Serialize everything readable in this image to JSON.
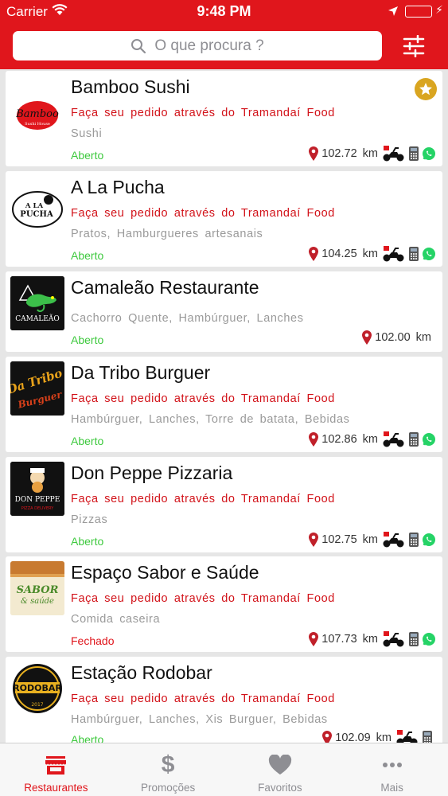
{
  "status_bar": {
    "carrier": "Carrier",
    "time": "9:48 PM",
    "battery_percent": 100
  },
  "search": {
    "placeholder": "O que procura ?"
  },
  "restaurants": [
    {
      "name": "Bamboo Sushi",
      "promo": "Faça seu pedido através do Tramandaí Food",
      "category": "Sushi",
      "status": "Aberto",
      "distance": "102.72",
      "unit": "km",
      "favorite": true,
      "delivery": true,
      "card_payment": true,
      "whatsapp": true,
      "logo_text": "Bamboo",
      "logo_sub": "Sushi House"
    },
    {
      "name": "A La Pucha",
      "promo": "Faça seu pedido através do Tramandaí Food",
      "category": "Pratos, Hamburgueres artesanais",
      "status": "Aberto",
      "distance": "104.25",
      "unit": "km",
      "favorite": false,
      "delivery": true,
      "card_payment": true,
      "whatsapp": true,
      "logo_text": "A LA PUCHA",
      "logo_sub": ""
    },
    {
      "name": "Camaleão Restaurante",
      "promo": "",
      "category": "Cachorro Quente, Hambúrguer, Lanches",
      "status": "Aberto",
      "distance": "102.00",
      "unit": "km",
      "favorite": false,
      "delivery": false,
      "card_payment": false,
      "whatsapp": false,
      "logo_text": "CAMALEÃO",
      "logo_sub": ""
    },
    {
      "name": "Da Tribo Burguer",
      "promo": "Faça seu pedido através do Tramandaí Food",
      "category": "Hambúrguer, Lanches, Torre de batata, Bebidas",
      "status": "Aberto",
      "distance": "102.86",
      "unit": "km",
      "favorite": false,
      "delivery": true,
      "card_payment": true,
      "whatsapp": true,
      "logo_text": "Da Tribo",
      "logo_sub": "Burguer"
    },
    {
      "name": "Don Peppe Pizzaria",
      "promo": "Faça seu pedido através do Tramandaí Food",
      "category": "Pizzas",
      "status": "Aberto",
      "distance": "102.75",
      "unit": "km",
      "favorite": false,
      "delivery": true,
      "card_payment": true,
      "whatsapp": true,
      "logo_text": "DON PEPPE",
      "logo_sub": "PIZZA DELIVERY"
    },
    {
      "name": "Espaço Sabor e Saúde",
      "promo": "Faça seu pedido através do Tramandaí Food",
      "category": "Comida caseira",
      "status": "Fechado",
      "distance": "107.73",
      "unit": "km",
      "favorite": false,
      "delivery": true,
      "card_payment": true,
      "whatsapp": true,
      "logo_text": "SABOR",
      "logo_sub": "& saúde"
    },
    {
      "name": "Estação Rodobar",
      "promo": "Faça seu pedido através do Tramandaí Food",
      "category": "Hambúrguer, Lanches, Xis Burguer, Bebidas",
      "status": "Aberto",
      "distance": "102.09",
      "unit": "km",
      "favorite": false,
      "delivery": true,
      "card_payment": true,
      "whatsapp": false,
      "logo_text": "RODOBAR",
      "logo_sub": "2017"
    }
  ],
  "tabs": [
    {
      "label": "Restaurantes",
      "icon": "store-icon",
      "active": true
    },
    {
      "label": "Promoções",
      "icon": "dollar-icon",
      "active": false
    },
    {
      "label": "Favoritos",
      "icon": "heart-icon",
      "active": false
    },
    {
      "label": "Mais",
      "icon": "more-icon",
      "active": false
    }
  ],
  "colors": {
    "brand": "#e0161c",
    "open": "#3ec93e",
    "closed": "#e0161c",
    "favorite": "#d9a520",
    "whatsapp": "#25d366"
  }
}
